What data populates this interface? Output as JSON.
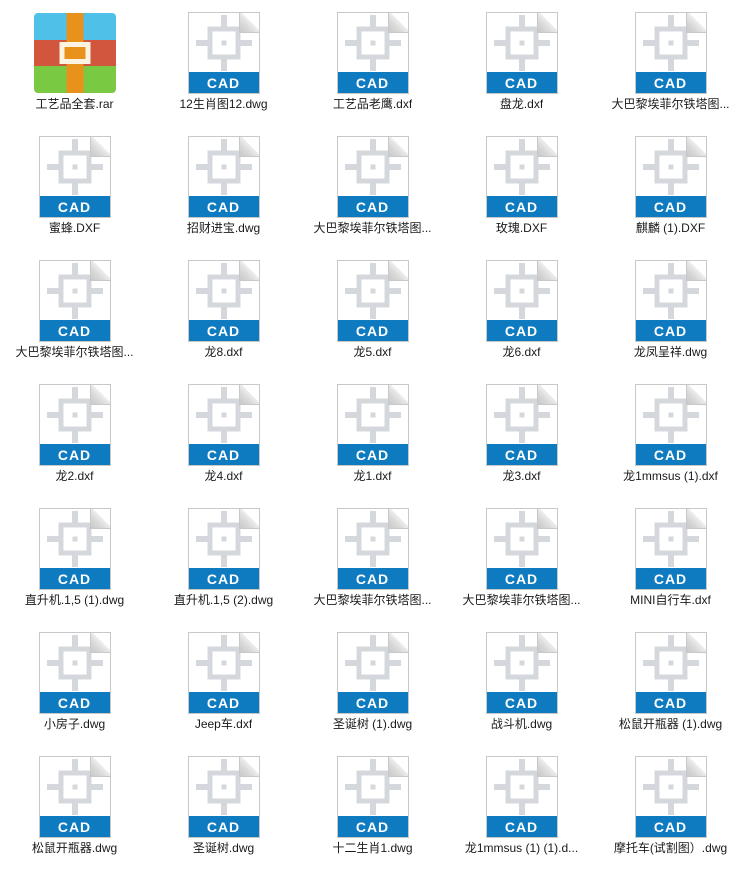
{
  "window": {
    "view": "large-icons",
    "background_color": "#ffffff",
    "label_color": "#1a1a1a"
  },
  "icons": {
    "cad_banner_text": "CAD",
    "cad_banner_color": "#0e7ac0",
    "cad_glyph_color": "#d4d8dc",
    "cad_page_border_color": "#c8c8c8",
    "rar_colors": {
      "top": "#4fc0e8",
      "middle": "#d2553e",
      "bottom": "#7ac943",
      "strap": "#e8921b",
      "buckle_border": "#fdf3e3"
    }
  },
  "files": [
    {
      "name": "工艺品全套.rar",
      "type": "rar"
    },
    {
      "name": "12生肖图12.dwg",
      "type": "cad"
    },
    {
      "name": "工艺品老鹰.dxf",
      "type": "cad"
    },
    {
      "name": "盘龙.dxf",
      "type": "cad"
    },
    {
      "name": "大巴黎埃菲尔铁塔图...",
      "type": "cad"
    },
    {
      "name": "蜜蜂.DXF",
      "type": "cad"
    },
    {
      "name": "招财进宝.dwg",
      "type": "cad"
    },
    {
      "name": "大巴黎埃菲尔铁塔图...",
      "type": "cad"
    },
    {
      "name": "玫瑰.DXF",
      "type": "cad"
    },
    {
      "name": "麒麟 (1).DXF",
      "type": "cad"
    },
    {
      "name": "大巴黎埃菲尔铁塔图...",
      "type": "cad"
    },
    {
      "name": "龙8.dxf",
      "type": "cad"
    },
    {
      "name": "龙5.dxf",
      "type": "cad"
    },
    {
      "name": "龙6.dxf",
      "type": "cad"
    },
    {
      "name": "龙凤呈祥.dwg",
      "type": "cad"
    },
    {
      "name": "龙2.dxf",
      "type": "cad"
    },
    {
      "name": "龙4.dxf",
      "type": "cad"
    },
    {
      "name": "龙1.dxf",
      "type": "cad"
    },
    {
      "name": "龙3.dxf",
      "type": "cad"
    },
    {
      "name": "龙1mmsus (1).dxf",
      "type": "cad"
    },
    {
      "name": "直升机.1,5 (1).dwg",
      "type": "cad"
    },
    {
      "name": "直升机.1,5 (2).dwg",
      "type": "cad"
    },
    {
      "name": "大巴黎埃菲尔铁塔图...",
      "type": "cad"
    },
    {
      "name": "大巴黎埃菲尔铁塔图...",
      "type": "cad"
    },
    {
      "name": "MINI自行车.dxf",
      "type": "cad"
    },
    {
      "name": "小房子.dwg",
      "type": "cad"
    },
    {
      "name": "Jeep车.dxf",
      "type": "cad"
    },
    {
      "name": "圣诞树 (1).dwg",
      "type": "cad"
    },
    {
      "name": "战斗机.dwg",
      "type": "cad"
    },
    {
      "name": "松鼠开瓶器 (1).dwg",
      "type": "cad"
    },
    {
      "name": "松鼠开瓶器.dwg",
      "type": "cad"
    },
    {
      "name": "圣诞树.dwg",
      "type": "cad"
    },
    {
      "name": "十二生肖1.dwg",
      "type": "cad"
    },
    {
      "name": "龙1mmsus (1) (1).d...",
      "type": "cad"
    },
    {
      "name": "摩托车(试割图）.dwg",
      "type": "cad"
    }
  ]
}
